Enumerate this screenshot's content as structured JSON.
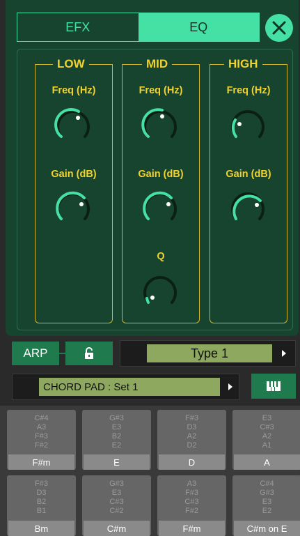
{
  "tabs": [
    {
      "label": "EFX",
      "active": false
    },
    {
      "label": "EQ",
      "active": true
    }
  ],
  "bands": [
    {
      "title": "LOW",
      "freq_label": "Freq (Hz)",
      "gain_label": "Gain (dB)"
    },
    {
      "title": "MID",
      "freq_label": "Freq (Hz)",
      "gain_label": "Gain (dB)",
      "q_label": "Q"
    },
    {
      "title": "HIGH",
      "freq_label": "Freq (Hz)",
      "gain_label": "Gain (dB)"
    }
  ],
  "controls": {
    "arp_label": "ARP",
    "type_value": "Type 1",
    "chord_set_value": "CHORD PAD : Set 1"
  },
  "pads": [
    {
      "notes": [
        "C#4",
        "A3",
        "F#3",
        "F#2"
      ],
      "chord": "F#m"
    },
    {
      "notes": [
        "G#3",
        "E3",
        "B2",
        "E2"
      ],
      "chord": "E"
    },
    {
      "notes": [
        "F#3",
        "D3",
        "A2",
        "D2"
      ],
      "chord": "D"
    },
    {
      "notes": [
        "E3",
        "C#3",
        "A2",
        "A1"
      ],
      "chord": "A"
    },
    {
      "notes": [
        "F#3",
        "D3",
        "B2",
        "B1"
      ],
      "chord": "Bm"
    },
    {
      "notes": [
        "G#3",
        "E3",
        "C#3",
        "C#2"
      ],
      "chord": "C#m"
    },
    {
      "notes": [
        "A3",
        "F#3",
        "C#3",
        "F#2"
      ],
      "chord": "F#m"
    },
    {
      "notes": [
        "C#4",
        "G#3",
        "E3",
        "E2"
      ],
      "chord": "C#m on E"
    }
  ],
  "colors": {
    "panel": "#17442f",
    "accent": "#45e0a4",
    "band_label": "#f2d22e",
    "button": "#1f7a4e",
    "field": "#8fa860"
  },
  "icons": [
    "close-icon",
    "lock-icon",
    "keyboard-icon",
    "arrow-right-icon"
  ]
}
